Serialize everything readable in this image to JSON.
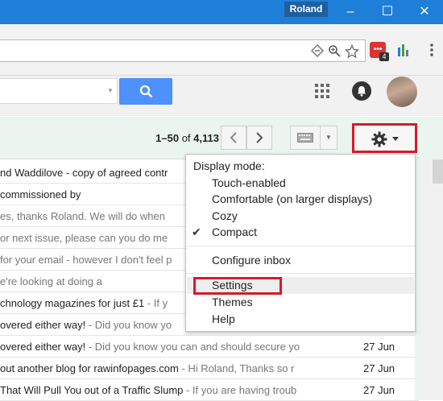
{
  "window": {
    "profile_name": "Roland",
    "minimize_glyph": "–",
    "maximize_glyph": "☐",
    "close_glyph": "✕"
  },
  "browser_toolbar": {
    "extension_icons": [
      "translate-icon",
      "zoom-icon",
      "star-icon",
      "lastpass-icon",
      "chart-extension-icon",
      "menu-icon"
    ],
    "lastpass_label": "•••",
    "lastpass_badge": "4"
  },
  "gmail": {
    "list_bar": {
      "range": "1–50",
      "of": "of",
      "total": "4,113"
    },
    "emails": [
      {
        "subject": "nd Waddilove - copy of agreed contr",
        "snippet": "",
        "date": ""
      },
      {
        "subject": "commissioned by",
        "snippet": "",
        "date": ""
      },
      {
        "subject": "",
        "snippet": "es, thanks Roland. We will do when",
        "date": ""
      },
      {
        "subject": "",
        "snippet": "or next issue, please can you do me",
        "date": ""
      },
      {
        "subject": "",
        "snippet": "for your email - however I don't feel p",
        "date": ""
      },
      {
        "subject": "",
        "snippet": "e're looking at doing a",
        "date": ""
      },
      {
        "subject": "chnology magazines for just £1",
        "snippet": " - If y",
        "date": ""
      },
      {
        "subject": "overed either way!",
        "snippet": " - Did you know yo",
        "date": ""
      },
      {
        "subject": "overed either way!",
        "snippet": " - Did you know you can and should secure yo",
        "date": "27 Jun"
      },
      {
        "subject": "out another blog for rawinfopages.com",
        "snippet": " - Hi Roland, Thanks so r",
        "date": "27 Jun"
      },
      {
        "subject": "That Will Pull You out of a Traffic Slump",
        "snippet": " - If you are having troub",
        "date": "27 Jun"
      }
    ],
    "settings_menu": {
      "display_mode_label": "Display mode:",
      "options": [
        {
          "label": "Touch-enabled",
          "checked": false
        },
        {
          "label": "Comfortable (on larger displays)",
          "checked": false
        },
        {
          "label": "Cozy",
          "checked": false
        },
        {
          "label": "Compact",
          "checked": true
        }
      ],
      "check_glyph": "✔",
      "configure_inbox": "Configure inbox",
      "settings": "Settings",
      "themes": "Themes",
      "help": "Help"
    },
    "colors": {
      "search_button": "#4d90fe",
      "highlight_box": "#d6192b",
      "list_bar_bg": "#e9f5ee"
    }
  }
}
